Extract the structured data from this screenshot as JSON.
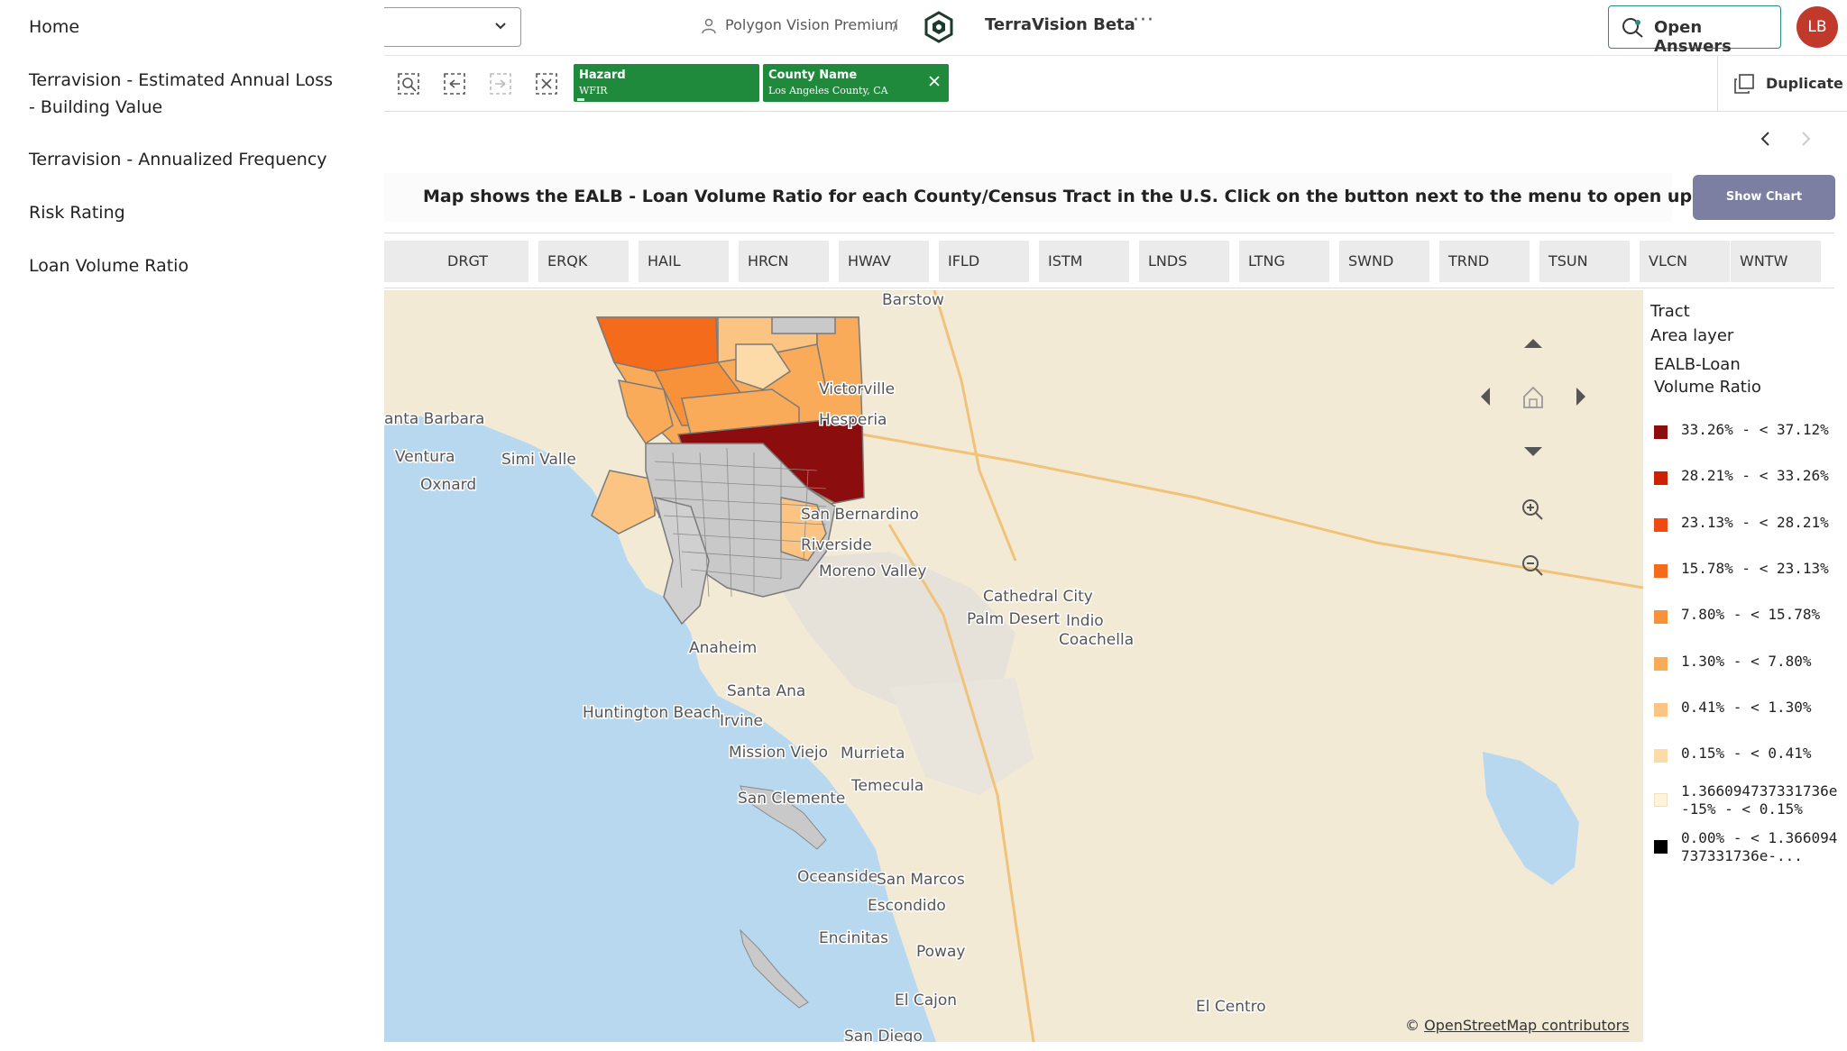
{
  "side_menu": {
    "items": [
      {
        "label": "Home"
      },
      {
        "label": "Terravision - Estimated Annual Loss - Building Value"
      },
      {
        "label": "Terravision - Annualized Frequency"
      },
      {
        "label": "Risk Rating"
      },
      {
        "label": "Loan Volume Ratio"
      }
    ]
  },
  "header": {
    "breadcrumb_space": "Polygon Vision Premium",
    "breadcrumb_separator": "/",
    "app_title": "TerraVision Beta",
    "more_icon": "ellipsis-icon",
    "open_answers_label": "Open Answers",
    "avatar_initials": "LB",
    "avatar_color": "#c0392b"
  },
  "selections": {
    "chips": [
      {
        "title": "Hazard",
        "value": "WFIR",
        "color": "#1f8a3c"
      },
      {
        "title": "County Name",
        "value": "Los Angeles County, CA",
        "color": "#1f8a3c"
      }
    ],
    "duplicate_label": "Duplicate"
  },
  "sheet": {
    "info_text": "Map shows the EALB - Loan Volume Ratio for each County/Census Tract in the U.S. Click on the button next to the menu to open up filters.",
    "show_chart_label": "Show Chart",
    "hazard_buttons": [
      "DRGT",
      "ERQK",
      "HAIL",
      "HRCN",
      "HWAV",
      "IFLD",
      "ISTM",
      "LNDS",
      "LTNG",
      "SWND",
      "TRND",
      "TSUN",
      "VLCN",
      "WNTW"
    ]
  },
  "map": {
    "place_labels": [
      "Barstow",
      "Victorville",
      "Hesperia",
      "anta Barbara",
      "Ventura",
      "Simi Valle",
      "Oxnard",
      "San Bernardino",
      "Riverside",
      "Moreno Valley",
      "Cathedral City",
      "Palm Desert",
      "Indio",
      "Coachella",
      "Anaheim",
      "Santa Ana",
      "Irvine",
      "Huntington Beach",
      "Mission Viejo",
      "Murrieta",
      "Temecula",
      "San Clemente",
      "Oceanside",
      "San Marcos",
      "Escondido",
      "Encinitas",
      "Poway",
      "El Cajon",
      "El Centro",
      "San Diego"
    ],
    "attribution_prefix": "©",
    "attribution_link": "OpenStreetMap contributors"
  },
  "legend": {
    "title_line1": "Tract",
    "title_line2": "Area layer",
    "measure_line1": "EALB-Loan",
    "measure_line2": "Volume Ratio",
    "items": [
      {
        "label": "33.26% - < 37.12%",
        "color": "#8b0d0d"
      },
      {
        "label": "28.21% - < 33.26%",
        "color": "#cc2200"
      },
      {
        "label": "23.13% - < 28.21%",
        "color": "#ee4a12"
      },
      {
        "label": "15.78% - < 23.13%",
        "color": "#f46b1c"
      },
      {
        "label": "7.80% - < 15.78%",
        "color": "#f7923a"
      },
      {
        "label": "1.30% - < 7.80%",
        "color": "#f9ab5a"
      },
      {
        "label": "0.41% - < 1.30%",
        "color": "#fbc483"
      },
      {
        "label": "0.15% - < 0.41%",
        "color": "#fddba8"
      },
      {
        "label": "1.366094737331736e-15% - < 0.15%",
        "color": "#fff4dc"
      },
      {
        "label": "0.00% - < 1.366094737331736e-...",
        "color": "#000000"
      }
    ]
  }
}
